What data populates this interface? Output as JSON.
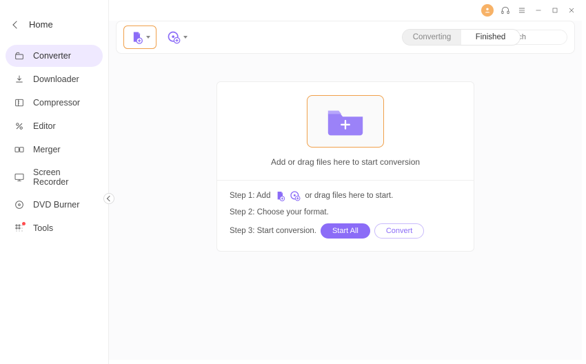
{
  "sidebar": {
    "home": "Home",
    "items": [
      {
        "label": "Converter"
      },
      {
        "label": "Downloader"
      },
      {
        "label": "Compressor"
      },
      {
        "label": "Editor"
      },
      {
        "label": "Merger"
      },
      {
        "label": "Screen Recorder"
      },
      {
        "label": "DVD Burner"
      },
      {
        "label": "Tools"
      }
    ]
  },
  "toolbar": {
    "tabs": {
      "converting": "Converting",
      "finished": "Finished"
    },
    "search_placeholder": "Search"
  },
  "drop": {
    "message": "Add or drag files here to start conversion",
    "step1_a": "Step 1: Add",
    "step1_b": "or drag files here to start.",
    "step2": "Step 2: Choose your format.",
    "step3": "Step 3: Start conversion.",
    "start_all": "Start All",
    "convert": "Convert"
  }
}
